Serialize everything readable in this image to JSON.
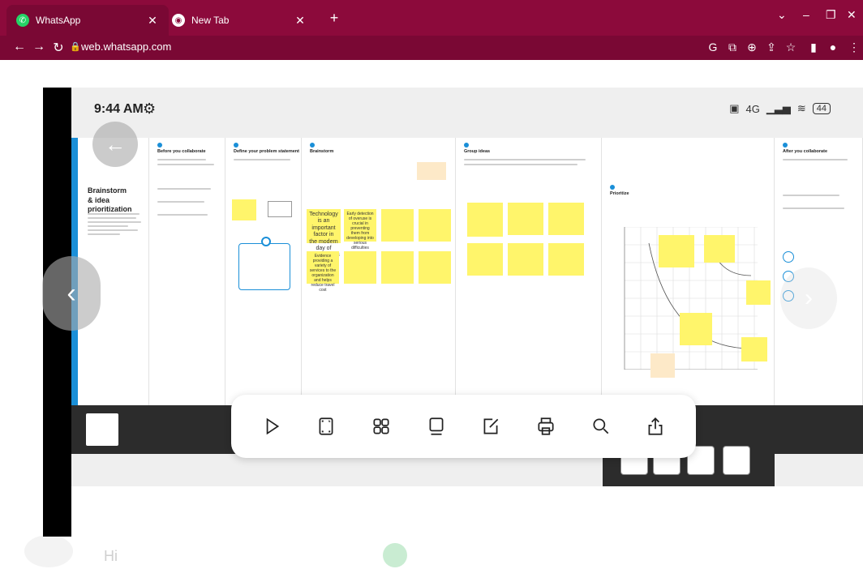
{
  "browser": {
    "tabs": [
      {
        "title": "WhatsApp",
        "active": true,
        "icon": "whatsapp-icon"
      },
      {
        "title": "New Tab",
        "active": false,
        "icon": "chrome-icon"
      }
    ],
    "url": "web.whatsapp.com",
    "accent": "#8c0a3b"
  },
  "phone": {
    "time": "9:44 AM",
    "signal": "4G",
    "battery": "44"
  },
  "board": {
    "title_line1": "Brainstorm",
    "title_line2": "& idea prioritization",
    "columns": [
      "Before you collaborate",
      "Define your problem statement",
      "Brainstorm",
      "Group ideas",
      "Prioritize",
      "After you collaborate"
    ],
    "stickies": {
      "s1": "Technology is an important factor in the modern day of automobiles",
      "s2": "Early detection of overuse is crucial in preventing them from developing into serious difficulties",
      "s3": "Evidence providing a variety of services to the organization and helps reduce travel cost"
    }
  },
  "chart_data": {
    "type": "scatter",
    "title": "",
    "xlabel": "",
    "ylabel": "",
    "grid": true,
    "series": [
      {
        "values": []
      }
    ]
  },
  "toolbar": {
    "items": [
      "play-icon",
      "fullscreen-icon",
      "grid-icon",
      "present-icon",
      "edit-icon",
      "print-icon",
      "search-icon",
      "share-icon"
    ]
  },
  "whatsapp": {
    "greeting": "Hi"
  }
}
